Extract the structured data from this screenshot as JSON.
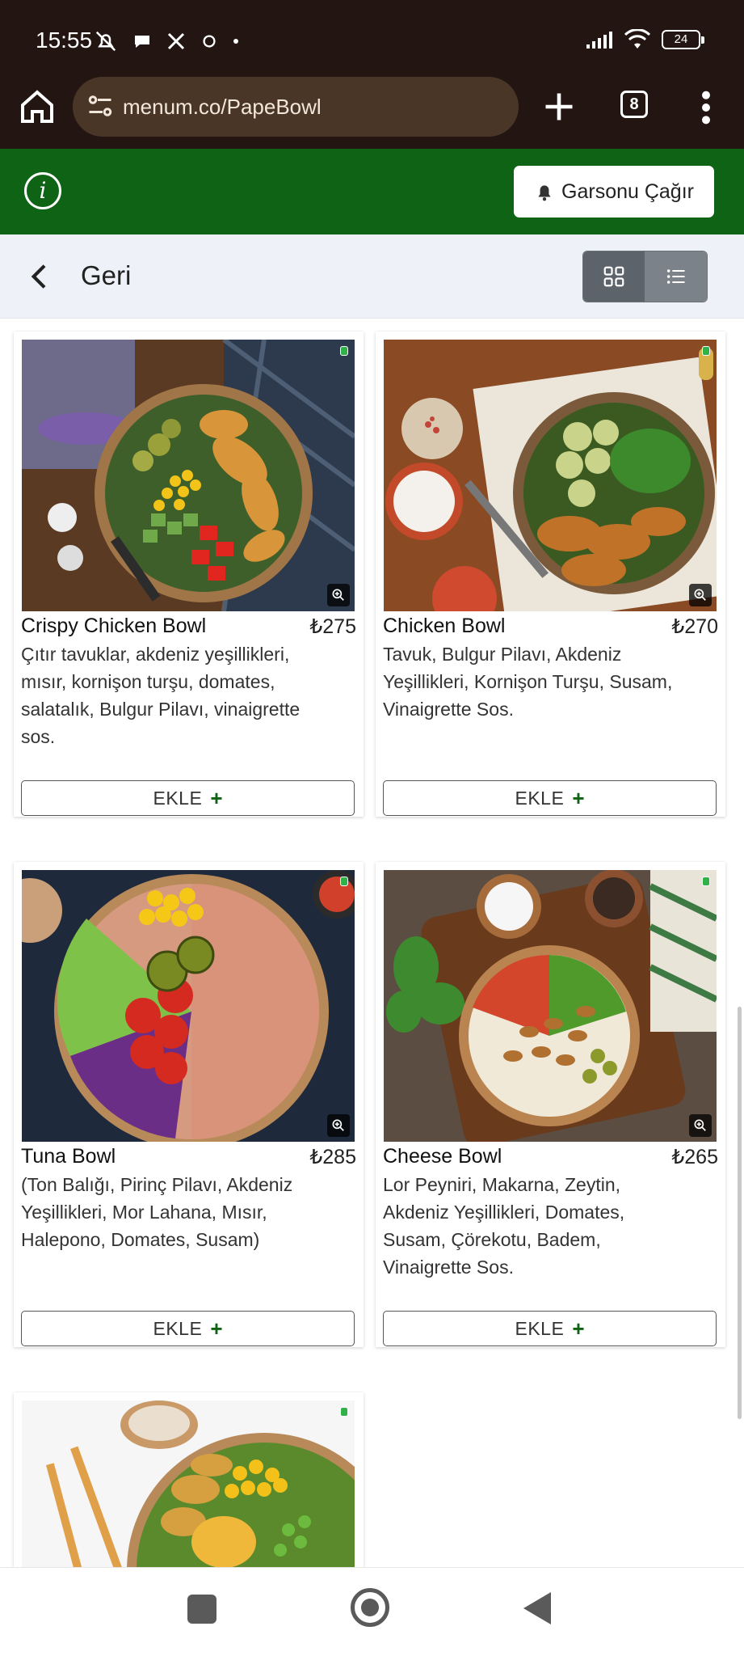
{
  "status_bar": {
    "time": "15:55",
    "battery": "24",
    "left_icons": [
      "mute-icon",
      "chat-icon",
      "x-icon",
      "sync-icon",
      "dot-icon"
    ],
    "right_icons": [
      "signal-icon",
      "wifi-icon",
      "battery-icon"
    ]
  },
  "browser": {
    "url": "menum.co/PapeBowl",
    "tab_count": "8"
  },
  "app_header": {
    "waiter_button_label": "Garsonu Çağır",
    "brand_color": "#0e6315"
  },
  "sub_header": {
    "back_label": "Geri",
    "view_mode": "grid"
  },
  "products": [
    {
      "name": "Crispy Chicken Bowl",
      "price": "₺275",
      "description": "Çıtır tavuklar, akdeniz yeşillikleri, mısır, kornişon turşu, domates, salatalık, Bulgur Pilavı, vinaigrette sos.",
      "add_label": "EKLE",
      "add_symbol": "+"
    },
    {
      "name": "Chicken Bowl",
      "price": "₺270",
      "description": "Tavuk, Bulgur Pilavı, Akdeniz Yeşillikleri, Kornişon Turşu, Susam, Vinaigrette Sos.",
      "add_label": "EKLE",
      "add_symbol": "+"
    },
    {
      "name": "Tuna Bowl",
      "price": "₺285",
      "description": "(Ton Balığı, Pirinç Pilavı, Akdeniz Yeşillikleri, Mor Lahana, Mısır, Halepono, Domates, Susam)",
      "add_label": "EKLE",
      "add_symbol": "+"
    },
    {
      "name": "Cheese Bowl",
      "price": "₺265",
      "description": "Lor Peyniri, Makarna, Zeytin, Akdeniz Yeşillikleri, Domates, Susam, Çörekotu, Badem, Vinaigrette Sos.",
      "add_label": "EKLE",
      "add_symbol": "+"
    }
  ]
}
